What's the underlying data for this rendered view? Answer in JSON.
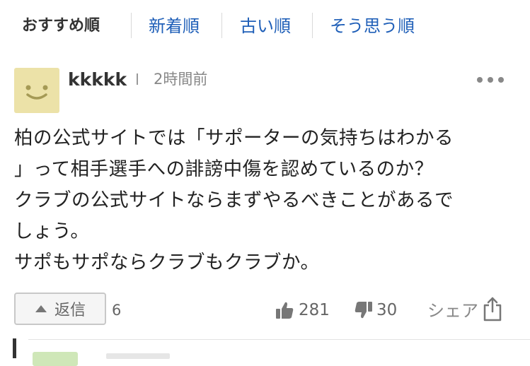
{
  "sort_tabs": [
    {
      "label": "おすすめ順",
      "active": true
    },
    {
      "label": "新着順",
      "active": false
    },
    {
      "label": "古い順",
      "active": false
    },
    {
      "label": "そう思う順",
      "active": false
    }
  ],
  "comment": {
    "username": "kkkkk",
    "time": "2時間前",
    "lines": [
      "柏の公式サイトでは「サポーターの気持ちはわかる",
      "」って相手選手への誹謗中傷を認めているのか？",
      "クラブの公式サイトならまずやるべきことがあるで",
      "しょう。",
      "サポもサポならクラブもクラブか。"
    ],
    "reply_label": "返信",
    "reply_count": "6",
    "likes": "281",
    "dislikes": "30",
    "share_label": "シェア"
  },
  "colors": {
    "link": "#1f5fb8",
    "avatar_bg": "#ece2a8",
    "avatar_face": "#a59a55"
  }
}
